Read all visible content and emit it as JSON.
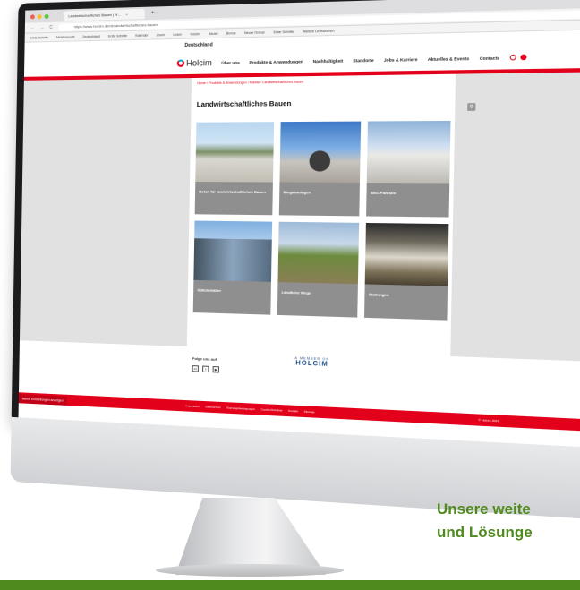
{
  "browser": {
    "tab_title": "Landwirtschaftliches Bauen | H…",
    "tab_close": "×",
    "tab_add": "+",
    "back": "←",
    "forward": "→",
    "reload": "C",
    "url": "https://www.holcim.de/de/landwirtschaftliches-bauen",
    "bookmarks": [
      "Erste Schritte",
      "Meistbesucht",
      "Deutschland",
      "Erste Schritte",
      "Kalender",
      "Zoom",
      "Lesen",
      "Holcim",
      "Bauen",
      "Bonus",
      "Neuer Ordner",
      "Erste Schritte",
      "Weitere Lesezeichen"
    ]
  },
  "site": {
    "country": "Deutschland",
    "logo": "Holcim",
    "menu": [
      "Über uns",
      "Produkte & Anwendungen",
      "Nachhaltigkeit",
      "Standorte",
      "Jobs & Karriere",
      "Aktuelles & Events",
      "Contacts"
    ],
    "breadcrumb": "Home  /  Produkte & Anwendungen  /  Märkte  /  Landwirtschaftliches Bauen",
    "page_title": "Landwirtschaftliches Bauen",
    "cards": [
      {
        "label": "Beton für landwirtschaftliches Bauen"
      },
      {
        "label": "Biogasanlagen"
      },
      {
        "label": "Silo-/Fahrsilo"
      },
      {
        "label": "Güllebehälter"
      },
      {
        "label": "Ländliche Wege"
      },
      {
        "label": "Stallungen"
      }
    ],
    "follow_label": "Folge uns auf:",
    "social": [
      "in",
      "f",
      "▶"
    ],
    "member_sub": "A MEMBER OF",
    "member_name": "HOLCIM",
    "footer_links": [
      "Impressum",
      "Datenschutz",
      "Nutzungsbedingungen",
      "Cookie-Richtlinie",
      "Kontakt",
      "Sitemap"
    ],
    "cookie_button": "Meine Einstellungen anzeigen",
    "copyright": "© Holcim 2023"
  },
  "promo": {
    "line1": "Unsere weite",
    "line2": "und Lösunge"
  },
  "colors": {
    "brand_red": "#e2001a",
    "holcim_blue": "#1d4e89",
    "promo_green": "#4f8a1f"
  }
}
